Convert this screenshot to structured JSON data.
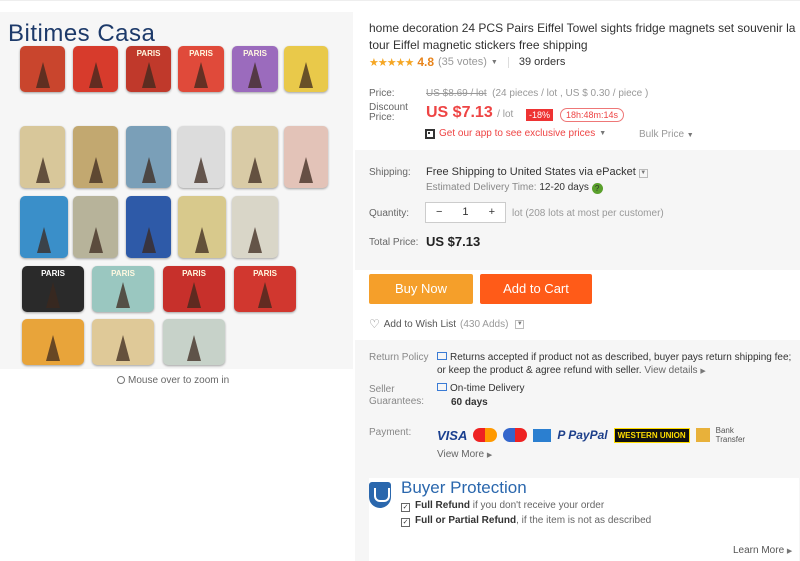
{
  "brand": "Bitimes Casa",
  "gallery": {
    "magnets": [
      {
        "text": "",
        "color": "#c9452d"
      },
      {
        "text": "",
        "color": "#d73b2c"
      },
      {
        "text": "PARIS",
        "color": "#c0392b"
      },
      {
        "text": "PARIS",
        "color": "#e04a3a"
      },
      {
        "text": "PARIS",
        "color": "#9b6bbd"
      },
      {
        "text": "",
        "color": "#e9c94a"
      },
      {
        "text": "",
        "color": "#d8c79a"
      },
      {
        "text": "",
        "color": "#c2a870"
      },
      {
        "text": "",
        "color": "#7a9fb8"
      },
      {
        "text": "",
        "color": "#dcdcdc"
      },
      {
        "text": "",
        "color": "#d9cba6"
      },
      {
        "text": "",
        "color": "#e3c3b8"
      },
      {
        "text": "",
        "color": "#3a8fc9"
      },
      {
        "text": "",
        "color": "#b7b39a"
      },
      {
        "text": "",
        "color": "#2e5aa8"
      },
      {
        "text": "",
        "color": "#d8c98c"
      },
      {
        "text": "",
        "color": "#d9d6c8"
      },
      {
        "text": "PARIS",
        "color": "#2a2a2a"
      },
      {
        "text": "PARIS",
        "color": "#9ac7c0"
      },
      {
        "text": "PARIS",
        "color": "#c7302b"
      },
      {
        "text": "PARIS",
        "color": "#d1372f"
      },
      {
        "text": "",
        "color": "#e8a43a"
      },
      {
        "text": "",
        "color": "#dfc998"
      },
      {
        "text": "",
        "color": "#c7d2c9"
      }
    ],
    "zoom_hint": "Mouse over to zoom in"
  },
  "product": {
    "title": "home decoration 24 PCS Pairs Eiffel Towel sights fridge magnets set souvenir la tour Eiffel magnetic stickers free shipping",
    "stars": "★★★★★",
    "rating": "4.8",
    "votes": "(35 votes)",
    "orders": "39 orders"
  },
  "price": {
    "price_label": "Price:",
    "old_price": "US $8.69 / lot",
    "old_price_detail": "(24 pieces / lot , US $ 0.30 / piece )",
    "discount_label": "Discount Price:",
    "current": "US $7.13",
    "unit": "/ lot",
    "badge": "-18%",
    "timer": "18h:48m:14s",
    "app_promo": "Get our app to see exclusive prices",
    "bulk": "Bulk Price"
  },
  "shipping": {
    "label": "Shipping:",
    "method_prefix": "Free Shipping",
    "method_rest": " to United States via ePacket",
    "est_label": "Estimated Delivery Time:",
    "est_value": "12-20 days",
    "qty_label": "Quantity:",
    "qty_minus": "−",
    "qty_value": "1",
    "qty_plus": "+",
    "lot_note": "lot (208 lots at most per customer)",
    "total_label": "Total Price:",
    "total_value": "US $7.13"
  },
  "actions": {
    "buy_now": "Buy Now",
    "add_to_cart": "Add to Cart",
    "wish": "Add to Wish List",
    "wish_count": "(430 Adds)"
  },
  "policy": {
    "return_label": "Return Policy",
    "return_text": "Returns accepted if product not as described, buyer pays return shipping fee; or keep the product & agree refund with seller.",
    "view_details": "View details",
    "seller_label": "Seller Guarantees:",
    "ontime": "On-time Delivery",
    "ontime_days": "60 days",
    "payment_label": "Payment:",
    "pay_visa": "VISA",
    "pay_paypal": "P PayPal",
    "pay_wu": "WESTERN UNION",
    "pay_bank": "Bank Transfer",
    "view_more": "View More"
  },
  "protection": {
    "title": "Buyer Protection",
    "full_refund": "Full Refund",
    "full_refund_rest": "if you don't receive your order",
    "partial_refund": "Full or Partial Refund",
    "partial_refund_rest": ", if the item is not as described",
    "learn_more": "Learn More"
  }
}
